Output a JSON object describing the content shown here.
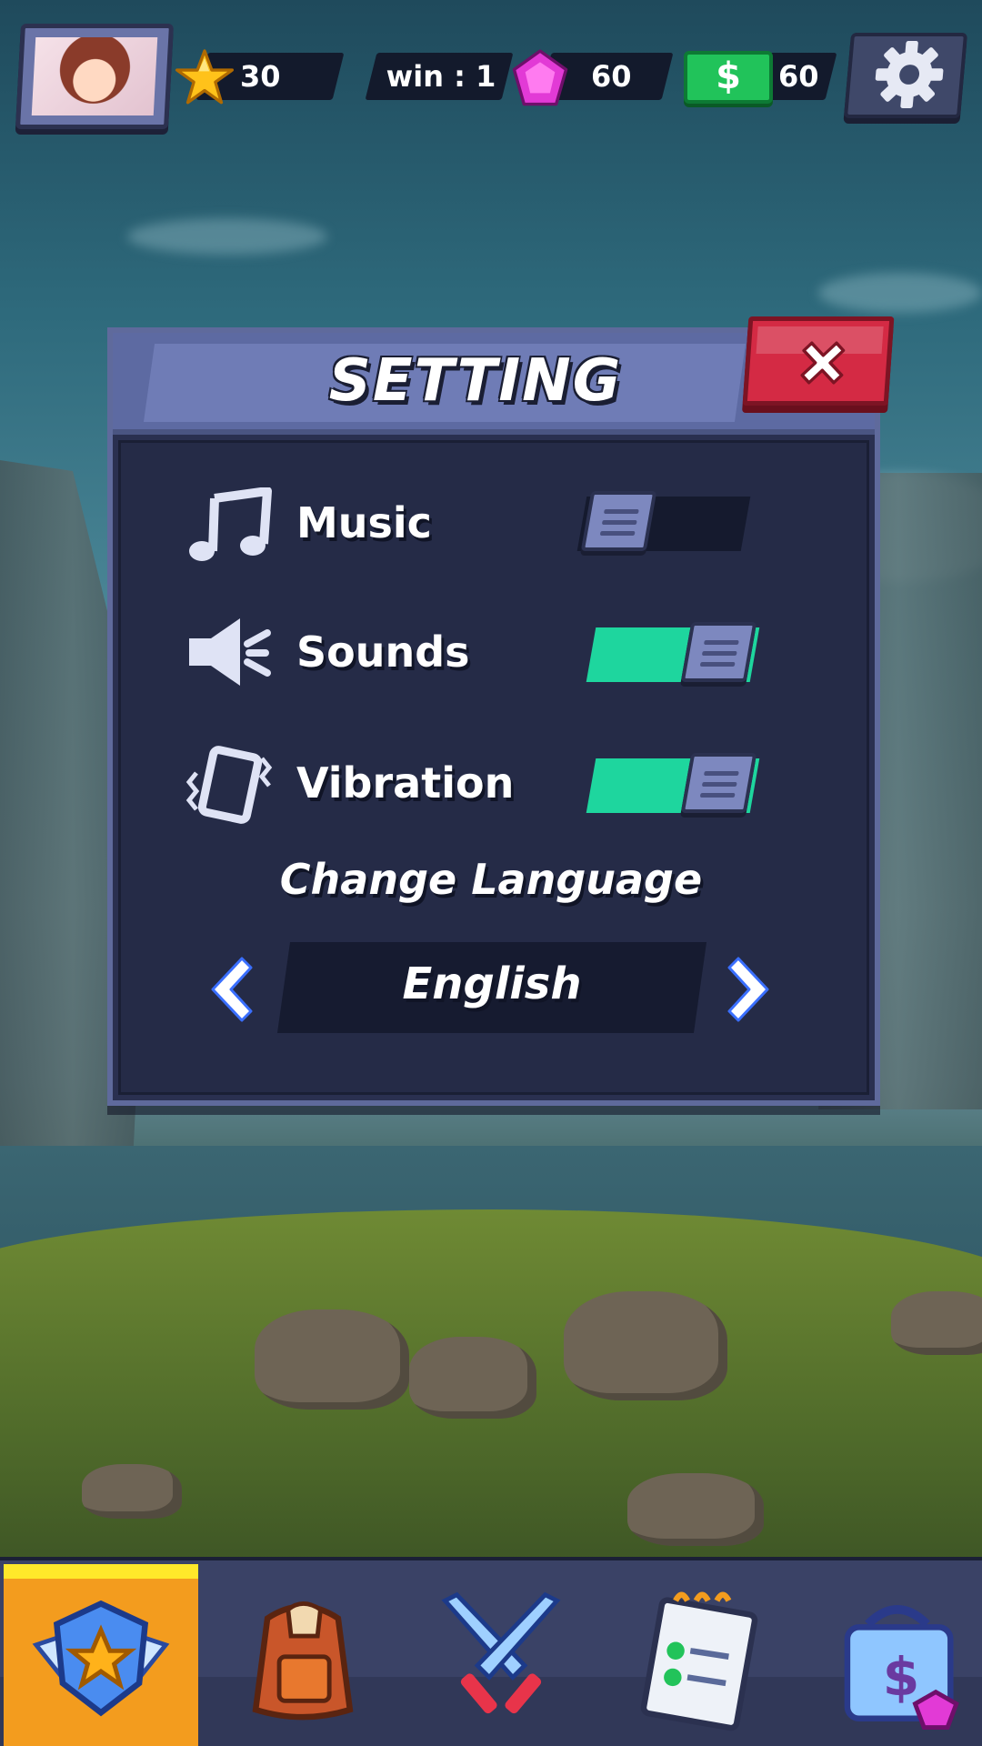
{
  "hud": {
    "stars": "30",
    "wins": "win : 1",
    "gems": "60",
    "cash_symbol": "$",
    "cash": "60",
    "icons": [
      "avatar",
      "star-icon",
      "gem-icon",
      "cash-icon",
      "gear-icon"
    ]
  },
  "settings": {
    "title": "SETTING",
    "rows": [
      {
        "label": "Music",
        "icon": "music-note-icon",
        "enabled": false
      },
      {
        "label": "Sounds",
        "icon": "speaker-icon",
        "enabled": true
      },
      {
        "label": "Vibration",
        "icon": "vibration-icon",
        "enabled": true
      }
    ],
    "language_title": "Change Language",
    "language_value": "English"
  },
  "nav": {
    "items": [
      "home-badge-icon",
      "backpack-icon",
      "crossed-swords-icon",
      "quest-checklist-icon",
      "shop-bag-icon"
    ],
    "active_index": 0
  },
  "colors": {
    "panel": "#2a3050",
    "panel_header": "#5d6aa2",
    "close_button": "#d42a44",
    "toggle_on": "#1ed69e",
    "nav_active": "#f39c1e",
    "nav_highlight": "#ffe82a"
  }
}
